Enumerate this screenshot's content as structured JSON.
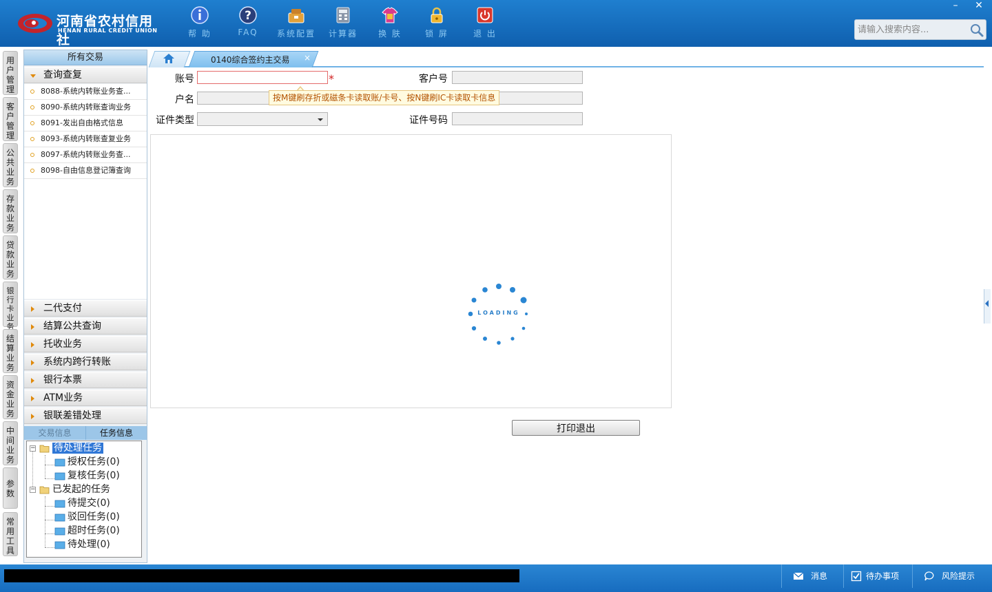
{
  "header": {
    "logo_cn": "河南省农村信用社",
    "logo_en": "HENAN RURAL CREDIT UNION",
    "tools": [
      {
        "label": "帮 助",
        "icon": "help-icon"
      },
      {
        "label": "FAQ",
        "icon": "faq-icon"
      },
      {
        "label": "系统配置",
        "icon": "system-config-icon"
      },
      {
        "label": "计算器",
        "icon": "calculator-icon"
      },
      {
        "label": "换 肤",
        "icon": "skin-icon"
      },
      {
        "label": "锁 屏",
        "icon": "lock-icon"
      },
      {
        "label": "退 出",
        "icon": "exit-icon"
      }
    ],
    "search_placeholder": "请输入搜索内容..."
  },
  "vertical_tabs": [
    "用户管理",
    "客户管理",
    "公共业务",
    "存款业务",
    "贷款业务",
    "银行卡业务",
    "结算业务",
    "资金业务",
    "中间业务",
    "参数",
    "常用工具"
  ],
  "menu": {
    "title": "所有交易",
    "expanded_category": "查询查复",
    "sub_items": [
      "8088-系统内转账业务查...",
      "8090-系统内转账查询业务",
      "8091-发出自由格式信息",
      "8093-系统内转账查复业务",
      "8097-系统内转账业务查...",
      "8098-自由信息登记簿查询"
    ],
    "collapsed_categories": [
      "二代支付",
      "结算公共查询",
      "托收业务",
      "系统内跨行转账",
      "银行本票",
      "ATM业务",
      "银联差错处理"
    ],
    "info_tabs": [
      "交易信息",
      "任务信息"
    ],
    "tree": {
      "pending_root": "待处理任务",
      "pending_children": [
        "授权任务(0)",
        "复核任务(0)"
      ],
      "initiated_root": "已发起的任务",
      "initiated_children": [
        "待提交(0)",
        "驳回任务(0)",
        "超时任务(0)",
        "待处理(0)"
      ]
    }
  },
  "tabs": {
    "active_label": "0140综合签约主交易",
    "close_glyph": "×"
  },
  "form": {
    "account_label": "账号",
    "customer_no_label": "客户号",
    "name_label": "户名",
    "id_type_label": "证件类型",
    "id_no_label": "证件号码",
    "hint": "按M键刷存折或磁条卡读取账/卡号、按N键刷IC卡读取卡信息",
    "required_mark": "*",
    "loading_text": "LOADING"
  },
  "buttons": {
    "print_exit": "打印退出"
  },
  "window": {
    "minimize": "–",
    "close": "✕"
  },
  "statusbar": {
    "message": "消息",
    "todo": "待办事项",
    "risk": "风险提示"
  }
}
